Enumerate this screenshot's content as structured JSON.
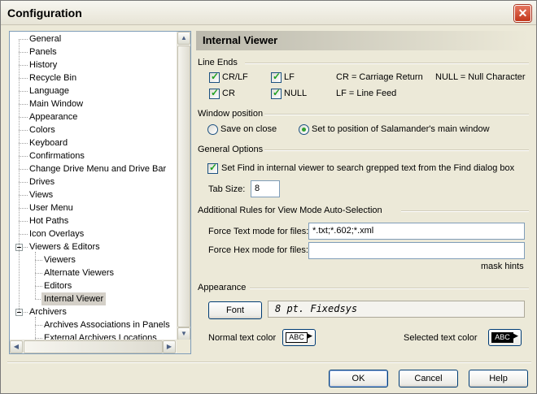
{
  "window": {
    "title": "Configuration"
  },
  "tree": {
    "items": [
      {
        "label": "General",
        "level": 0
      },
      {
        "label": "Panels",
        "level": 0
      },
      {
        "label": "History",
        "level": 0
      },
      {
        "label": "Recycle Bin",
        "level": 0
      },
      {
        "label": "Language",
        "level": 0
      },
      {
        "label": "Main Window",
        "level": 0
      },
      {
        "label": "Appearance",
        "level": 0
      },
      {
        "label": "Colors",
        "level": 0
      },
      {
        "label": "Keyboard",
        "level": 0
      },
      {
        "label": "Confirmations",
        "level": 0
      },
      {
        "label": "Change Drive Menu and Drive Bar",
        "level": 0
      },
      {
        "label": "Drives",
        "level": 0
      },
      {
        "label": "Views",
        "level": 0
      },
      {
        "label": "User Menu",
        "level": 0
      },
      {
        "label": "Hot Paths",
        "level": 0
      },
      {
        "label": "Icon Overlays",
        "level": 0
      },
      {
        "label": "Viewers & Editors",
        "level": 0,
        "expanded": true
      },
      {
        "label": "Viewers",
        "level": 1
      },
      {
        "label": "Alternate Viewers",
        "level": 1
      },
      {
        "label": "Editors",
        "level": 1
      },
      {
        "label": "Internal Viewer",
        "level": 1,
        "selected": true
      },
      {
        "label": "Archivers",
        "level": 0,
        "expanded": true
      },
      {
        "label": "Archives Associations in Panels",
        "level": 1
      },
      {
        "label": "External Archivers Locations",
        "level": 1
      }
    ]
  },
  "page": {
    "header": "Internal Viewer",
    "line_ends": {
      "title": "Line Ends",
      "crlf": {
        "label": "CR/LF",
        "checked": true
      },
      "lf": {
        "label": "LF",
        "checked": true
      },
      "cr": {
        "label": "CR",
        "checked": true
      },
      "null": {
        "label": "NULL",
        "checked": true
      },
      "legend_cr": "CR = Carriage Return",
      "legend_null": "NULL = Null Character",
      "legend_lf": "LF = Line Feed"
    },
    "window_position": {
      "title": "Window position",
      "save_on_close": {
        "label": "Save on close",
        "selected": false
      },
      "set_to_main": {
        "label": "Set to position of Salamander's main window",
        "selected": true
      }
    },
    "general_options": {
      "title": "General Options",
      "find_option": {
        "label": "Set Find in internal viewer to search grepped text from the Find dialog box",
        "checked": true
      },
      "tab_size_label": "Tab Size:",
      "tab_size_value": "8"
    },
    "auto_selection": {
      "title": "Additional Rules for View Mode Auto-Selection",
      "text_mode_label": "Force Text mode for files:",
      "text_mode_value": "*.txt;*.602;*.xml",
      "hex_mode_label": "Force Hex mode for files:",
      "hex_mode_value": "",
      "mask_hints": "mask hints"
    },
    "appearance": {
      "title": "Appearance",
      "font_button": "Font",
      "font_preview": "8 pt. Fixedsys",
      "normal_color_label": "Normal text color",
      "normal_swatch": "ABC",
      "selected_color_label": "Selected text color",
      "selected_swatch": "ABC"
    }
  },
  "buttons": {
    "ok": "OK",
    "cancel": "Cancel",
    "help": "Help"
  },
  "colors": {
    "accent": "#003c74",
    "check": "#21a121",
    "close": "#c2361a"
  }
}
